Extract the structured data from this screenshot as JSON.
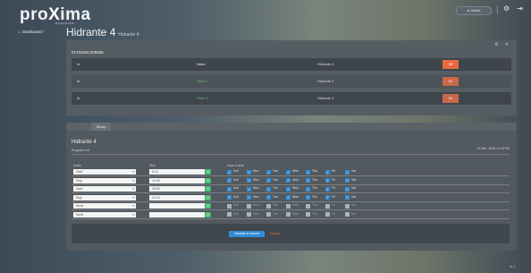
{
  "brand": {
    "logo_text": "pro",
    "logo_x": "X",
    "logo_tail": "ima",
    "logo_sub": "systems"
  },
  "header": {
    "status": "● Online",
    "settings_icon": "gear-icon",
    "exit_icon": "logout-icon"
  },
  "breadcrumb": {
    "home": "⌂",
    "label": "Dashboard",
    "sep": "›"
  },
  "page": {
    "title": "Hidrante 4",
    "subtitle": "Hidrante 4"
  },
  "valves_panel": {
    "controls": "⚙ ✕",
    "device_id": "0170420C408065",
    "header": {
      "col1": "Id",
      "col2": "Valve",
      "col3": "Hidrante 4",
      "btn": "Off"
    },
    "rows": [
      {
        "id": "id",
        "valve": "Valve 1",
        "name": "Hidrante 4",
        "btn": "On"
      },
      {
        "id": "id",
        "valve": "Valve 2",
        "name": "Hidrante 4",
        "btn": "On"
      }
    ]
  },
  "tabs": {
    "active": "Setup"
  },
  "schedule": {
    "title": "Hidrante 4",
    "program_label": "Program List",
    "datetime": "12 Dec, 2018 12:16 PM",
    "headers": {
      "action": "Action",
      "time": "Time",
      "days": "Days of week"
    },
    "days": [
      "Sun",
      "Mon",
      "Tue",
      "Wed",
      "Thu",
      "Fri",
      "Sat"
    ],
    "rows": [
      {
        "action": "Start",
        "time": "8:15",
        "active": true
      },
      {
        "action": "Stop",
        "time": "10:05",
        "active": true
      },
      {
        "action": "Start",
        "time": "20:50",
        "active": true
      },
      {
        "action": "Stop",
        "time": "21:15",
        "active": true
      },
      {
        "action": "None",
        "time": "",
        "active": false
      },
      {
        "action": "None",
        "time": "",
        "active": false
      }
    ],
    "save_label": "Validate & Submit",
    "cancel_label": "Cancel"
  },
  "footer": {
    "version": "v1.0"
  }
}
